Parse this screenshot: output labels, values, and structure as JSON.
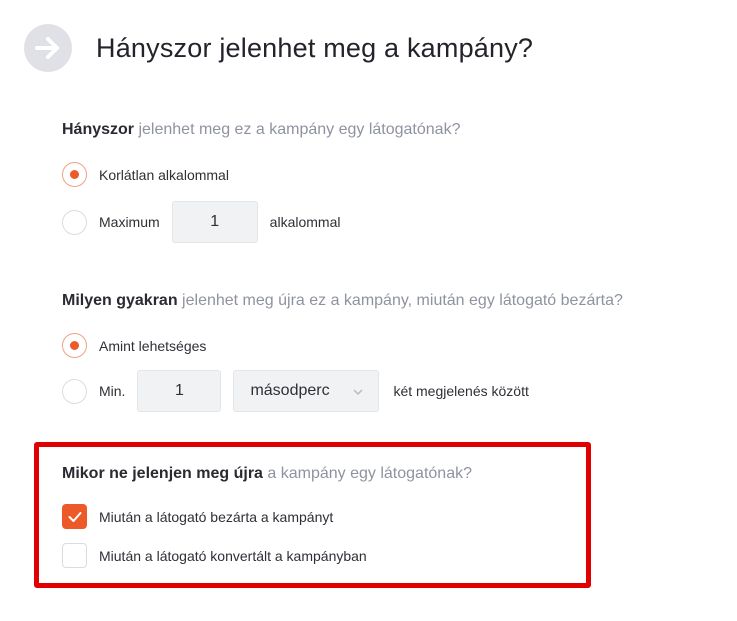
{
  "header": {
    "title": "Hányszor jelenhet meg a kampány?",
    "icon": "arrow-right-icon"
  },
  "colors": {
    "accent": "#ed5a29",
    "highlight": "#e00000",
    "muted_text": "#8f93a0"
  },
  "section1": {
    "question_strong": "Hányszor",
    "question_rest": " jelenhet meg ez a kampány egy látogatónak?",
    "options": [
      {
        "label": "Korlátlan alkalommal",
        "checked": true
      },
      {
        "label_prefix": "Maximum",
        "value": "1",
        "label_suffix": "alkalommal",
        "checked": false
      }
    ]
  },
  "section2": {
    "question_strong": "Milyen gyakran",
    "question_rest": " jelenhet meg újra ez a kampány, miután egy látogató bezárta?",
    "options": [
      {
        "label": "Amint lehetséges",
        "checked": true
      },
      {
        "label_prefix": "Min.",
        "value": "1",
        "unit": "másodperc",
        "label_suffix": "két megjelenés között",
        "checked": false
      }
    ]
  },
  "section3": {
    "question_strong": "Mikor ne jelenjen meg újra",
    "question_rest": " a kampány egy látogatónak?",
    "options": [
      {
        "label": "Miután a látogató bezárta a kampányt",
        "checked": true
      },
      {
        "label": "Miután a látogató konvertált a kampányban",
        "checked": false
      }
    ]
  }
}
